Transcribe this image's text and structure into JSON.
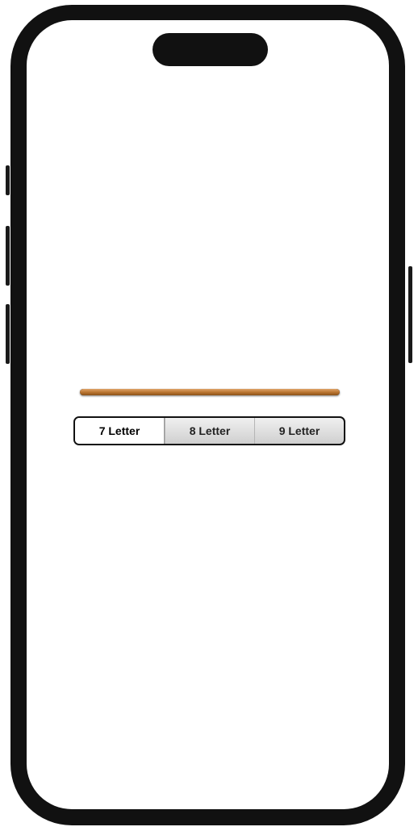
{
  "progress": {
    "value": 1.0,
    "color": "#b8732f"
  },
  "segmented_control": {
    "selected_index": 0,
    "options": [
      "7 Letter",
      "8 Letter",
      "9 Letter"
    ]
  },
  "device": {
    "frame_color": "#111111",
    "screen_color": "#ffffff"
  }
}
